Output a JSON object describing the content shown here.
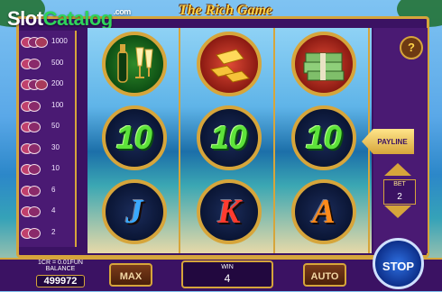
{
  "logo": {
    "slot": "Slot",
    "catalog": "Catalog",
    "suffix": ".com"
  },
  "title": "The Rich Game",
  "paytable": [
    {
      "value": "1000",
      "coins": 3
    },
    {
      "value": "500",
      "coins": 2
    },
    {
      "value": "200",
      "coins": 3
    },
    {
      "value": "100",
      "coins": 2
    },
    {
      "value": "50",
      "coins": 2
    },
    {
      "value": "30",
      "coins": 2
    },
    {
      "value": "10",
      "coins": 2
    },
    {
      "value": "6",
      "coins": 2
    },
    {
      "value": "4",
      "coins": 2
    },
    {
      "value": "2",
      "coins": 2
    }
  ],
  "reels": [
    [
      {
        "type": "champagne",
        "icon": "champagne-icon"
      },
      {
        "type": "ten",
        "text": "10"
      },
      {
        "type": "letter",
        "text": "J",
        "color": "#3aa9ff"
      }
    ],
    [
      {
        "type": "gold",
        "icon": "gold-bars-icon"
      },
      {
        "type": "ten",
        "text": "10"
      },
      {
        "type": "letter",
        "text": "K",
        "color": "#ff3b2f"
      }
    ],
    [
      {
        "type": "cash",
        "icon": "money-stack-icon"
      },
      {
        "type": "ten",
        "text": "10"
      },
      {
        "type": "letter",
        "text": "A",
        "color": "#ff8a1a"
      }
    ]
  ],
  "sidebar": {
    "help": "?",
    "payline": "PAYLINE",
    "bet_label": "BET",
    "bet_value": "2"
  },
  "bottom": {
    "conversion": "1CR = 0.01FUN",
    "balance_label": "BALANCE",
    "balance_value": "499972",
    "max": "MAX",
    "win_label": "WIN",
    "win_value": "4",
    "auto": "AUTO",
    "stop": "STOP"
  },
  "colors": {
    "gold": "#d6a53b",
    "panel": "#3b1263",
    "green_ten": "#5de33a"
  }
}
